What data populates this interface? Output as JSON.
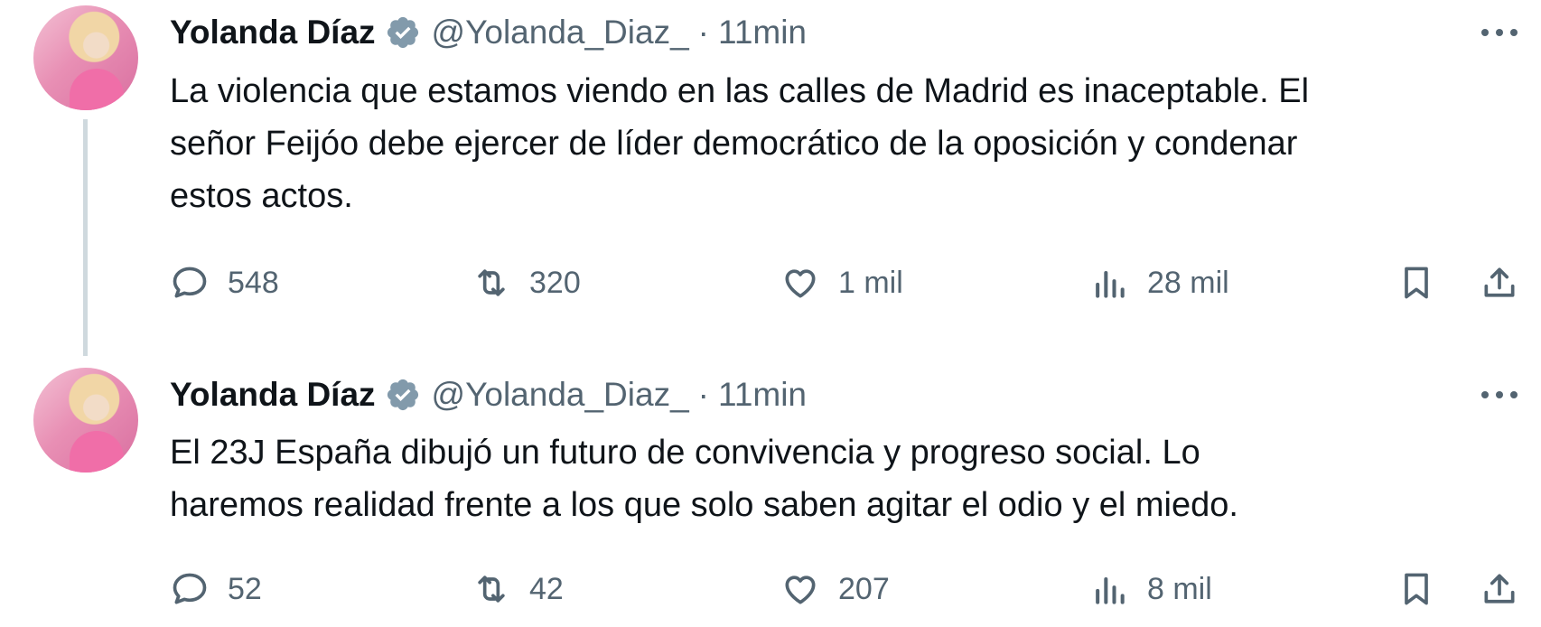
{
  "tweets": [
    {
      "author_name": "Yolanda Díaz",
      "handle": "@Yolanda_Diaz_",
      "separator": "·",
      "time": "11min",
      "text": "La violencia que estamos viendo en las calles de Madrid es inaceptable. El\nseñor Feijóo debe ejercer de líder democrático de la oposición y condenar\nestos actos.",
      "replies": "548",
      "retweets": "320",
      "likes": "1 mil",
      "views": "28 mil"
    },
    {
      "author_name": "Yolanda Díaz",
      "handle": "@Yolanda_Diaz_",
      "separator": "·",
      "time": "11min",
      "text": "El 23J España dibujó un futuro de convivencia y progreso social. Lo\nharemos realidad frente a los que solo saben agitar el odio y el miedo.",
      "replies": "52",
      "retweets": "42",
      "likes": "207",
      "views": "8 mil"
    }
  ],
  "colors": {
    "text": "#0f1419",
    "secondary": "#536471",
    "verified": "#829aab",
    "thread_line": "#cfd9de"
  },
  "icons": [
    "verified-badge-icon",
    "more-icon",
    "reply-icon",
    "retweet-icon",
    "like-icon",
    "views-icon",
    "bookmark-icon",
    "share-icon"
  ]
}
